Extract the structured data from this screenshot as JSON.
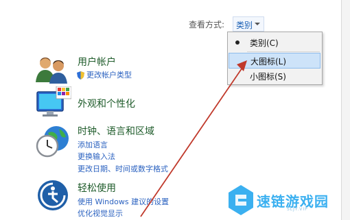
{
  "view_by": {
    "label": "查看方式:",
    "selected": "类别"
  },
  "menu": {
    "items": [
      {
        "label": "类别(C)",
        "checked": true
      },
      {
        "label": "大图标(L)",
        "highlighted": true
      },
      {
        "label": "小图标(S)"
      }
    ]
  },
  "categories": [
    {
      "title": "用户帐户",
      "icon": "users-icon",
      "links": [
        "更改帐户类型"
      ]
    },
    {
      "title": "外观和个性化",
      "icon": "monitor-palette-icon",
      "links": []
    },
    {
      "title": "时钟、语言和区域",
      "icon": "clock-globe-icon",
      "links": [
        "添加语言",
        "更换输入法",
        "更改日期、时间或数字格式"
      ]
    },
    {
      "title": "轻松使用",
      "icon": "ease-of-access-icon",
      "links": [
        "使用 Windows 建议的设置",
        "优化视觉显示"
      ]
    }
  ],
  "watermark": {
    "text": "速链游戏园",
    "url": "SLJY.VIP"
  },
  "colors": {
    "category_title": "#1e5b2a",
    "link": "#2b62c0",
    "menu_highlight": "#cde3f9",
    "arrow": "#c0392b",
    "watermark": "#3bb0f0"
  }
}
